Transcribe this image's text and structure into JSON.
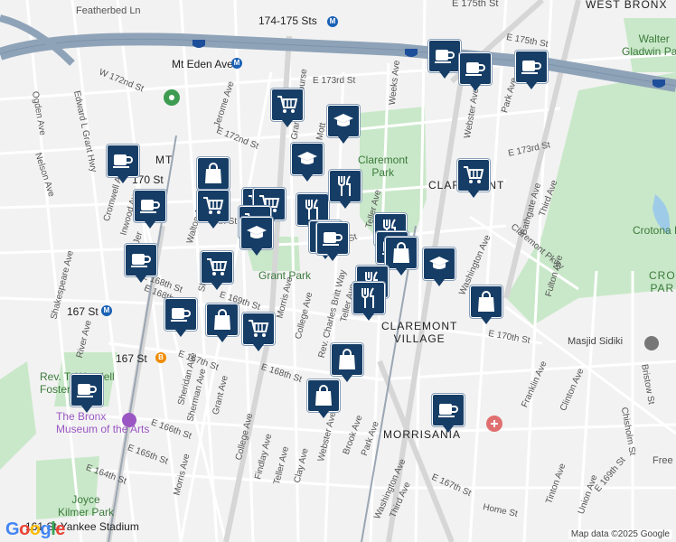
{
  "colors": {
    "background": "#f2f2f2",
    "park": "#c9e8c9",
    "highway": "#8fa3b8",
    "highway_stroke": "#7d93aa",
    "marker": "#163d66",
    "transit": "#1a61b5",
    "hospital": "#e07070",
    "museum": "#9a57c4"
  },
  "labels": {
    "featherbed": "Featherbed Ln",
    "e175_top": "E 175th St",
    "west_bronx": "WEST BRONX",
    "walter_gladwin_park": "Walter\nGladwin Park",
    "st174175": "174-175 Sts",
    "mt_eden_ave": "Mt Eden Ave",
    "e175": "E 175th St",
    "e173": "E 173rd St",
    "w172": "W 172nd St",
    "e172": "E 172nd St",
    "weeks_ave": "Weeks Ave",
    "jerome": "Jerome Ave",
    "grand_concourse": "Grand Concourse",
    "edward_l_grant": "Edward L Grant Hwy",
    "ogden": "Ogden Ave",
    "nelson": "Nelson Ave",
    "cromwell": "Cromwell Ave",
    "inwood": "Inwood Ave",
    "st170": "170 St",
    "mt_station": "Mt Eden Ave",
    "claremont_park": "Claremont\nPark",
    "claremont": "CLAREMONT",
    "e173_right": "E 173rd St",
    "park_ave_right": "Park Ave",
    "webster_top": "Webster Ave",
    "bathgate": "Bathgate Ave",
    "third_ave_top": "Third Ave",
    "claremont_pkwy": "Claremont Pkwy",
    "crotona_park": "Crotona Park",
    "crotona_right": "CRO\nPAR",
    "e169": "169th St",
    "e168": "E 168th St",
    "e169_st": "E 169th St",
    "grant_park": "Grant Park",
    "shakespeare": "Shakespeare Ave",
    "river_ave": "River Ave",
    "st167": "167 St",
    "st167b": "167 St",
    "morris_ave": "Morris Ave",
    "college_ave": "College Ave",
    "rev_charles": "Rev. Charles Britt Way",
    "teller_ave": "Teller Ave",
    "washington_ave": "Washington Ave",
    "fulton_ave": "Fulton Ave",
    "claremont_village": "CLAREMONT\nVILLAGE",
    "e170": "E 170th St",
    "masjid": "Masjid Sidiki",
    "bristow": "Bristow St",
    "franklin": "Franklin Ave",
    "clinton": "Clinton Ave",
    "chisholm": "Chisholm St",
    "e167th": "E 167th St",
    "sheridan": "Sheridan Ave",
    "sherman": "Sherman Ave",
    "grant_ave": "Grant Ave",
    "e166": "E 166th St",
    "e168th": "E 168th St",
    "rev_wendell": "Rev. T. Wendell\nFoster Park",
    "bronx_museum": "The Bronx\nMuseum of the Arts",
    "e165": "E 165th St",
    "e164": "E 164th St",
    "morris_lower": "Morris Ave",
    "college_lower": "College Ave",
    "findlay": "Findlay Ave",
    "teller_lower": "Teller Ave",
    "clay": "Clay Ave",
    "webster_lower": "Webster Ave",
    "brook": "Brook Ave",
    "park_lower": "Park Ave",
    "washington_lower": "Washington Ave",
    "third_lower": "Third Ave",
    "morrisania": "MORRISANIA",
    "e167_lower": "E 167th St",
    "tinton": "Tinton Ave",
    "union": "Union Ave",
    "e169_lower": "E 169th St",
    "home_st": "Home St",
    "free": "Free",
    "joyce_kilmer": "Joyce\nKilmer Park",
    "yankee": "161 St-Yankee Stadium",
    "e170_label": "0th St",
    "e170b": "70th St",
    "mt_label": "MT",
    "jer": "Jer",
    "walton": "Walton Ave",
    "sheridan_upper": "Sheridan",
    "teller_mid": "Teller Ave",
    "e168_mid": "E 168th St",
    "e169_mid": "E 169th St",
    "college_mid": "College Ave",
    "morris_mid": "Morris Ave",
    "e168_left": "E 168th St",
    "eastburn": "Eastburn Ave",
    "mott": "Mott",
    "weeks": "Weeks Ave",
    "highway_95a": "95",
    "highway_95b": "95",
    "highway_95c": "95"
  },
  "markers": [
    {
      "type": "cafe-icon"
    },
    {
      "type": "cafe-icon"
    },
    {
      "type": "cafe-icon"
    },
    {
      "type": "cart-icon"
    },
    {
      "type": "school-icon"
    },
    {
      "type": "cafe-icon"
    },
    {
      "type": "cafe-icon"
    },
    {
      "type": "shopping-bag-icon"
    },
    {
      "type": "school-icon"
    },
    {
      "type": "restaurant-icon"
    },
    {
      "type": "cart-icon"
    },
    {
      "type": "cafe-icon"
    },
    {
      "type": "cart-icon"
    },
    {
      "type": "cart-icon"
    },
    {
      "type": "cart-icon"
    },
    {
      "type": "restaurant-icon"
    },
    {
      "type": "cafe-icon"
    },
    {
      "type": "school-icon"
    },
    {
      "type": "restaurant-icon"
    },
    {
      "type": "cafe-icon"
    },
    {
      "type": "shopping-bag-icon"
    },
    {
      "type": "cart-icon"
    },
    {
      "type": "school-icon"
    },
    {
      "type": "cafe-icon"
    },
    {
      "type": "restaurant-icon"
    },
    {
      "type": "restaurant-icon"
    },
    {
      "type": "shopping-bag-icon"
    },
    {
      "type": "cafe-icon"
    },
    {
      "type": "shopping-bag-icon"
    },
    {
      "type": "cart-icon"
    },
    {
      "type": "shopping-bag-icon"
    },
    {
      "type": "shopping-bag-icon"
    },
    {
      "type": "cafe-icon"
    },
    {
      "type": "cafe-icon"
    },
    {
      "type": "cart-icon"
    }
  ],
  "google_logo": "Google",
  "attribution": "Map data ©2025 Google"
}
